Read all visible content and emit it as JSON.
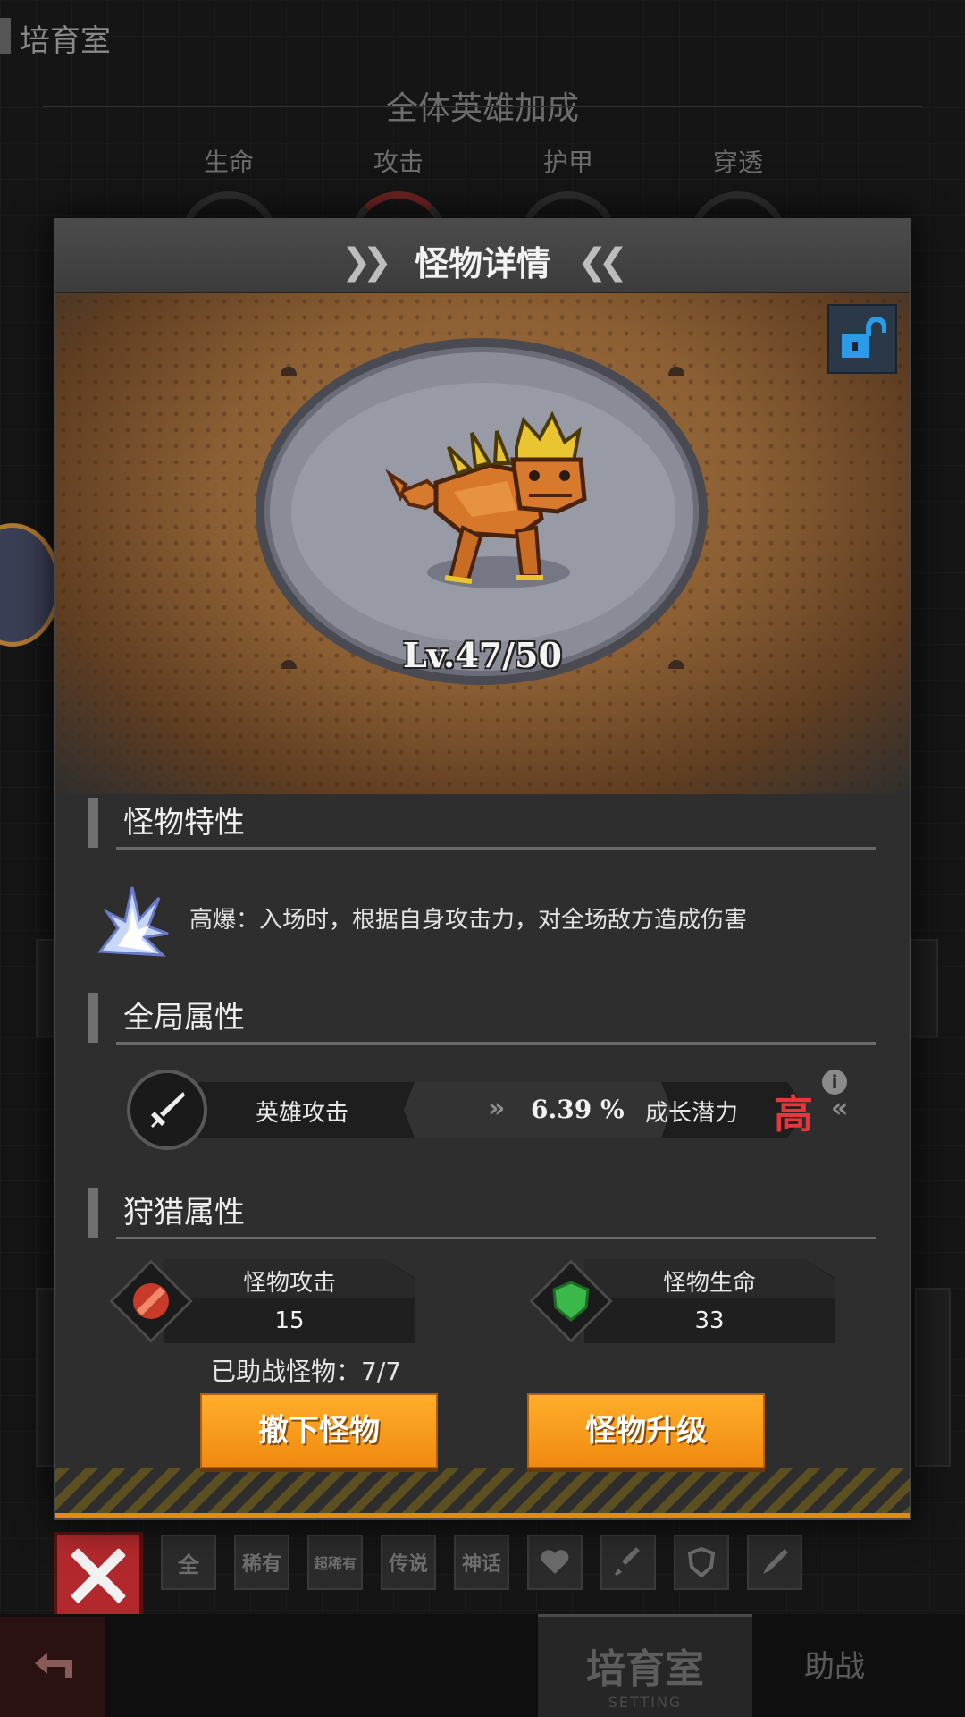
{
  "background": {
    "screen_title": "培育室",
    "bonus_title": "全体英雄加成",
    "stats": [
      {
        "label": "生命"
      },
      {
        "label": "攻击"
      },
      {
        "label": "护甲"
      },
      {
        "label": "穿透"
      }
    ]
  },
  "modal": {
    "title": "怪物详情",
    "level": "Lv.47/50",
    "sections": {
      "trait": "怪物特性",
      "global": "全局属性",
      "hunt": "狩猎属性"
    },
    "trait_text": "高爆：入场时，根据自身攻击力，对全场敌方造成伤害",
    "global_attr": {
      "name": "英雄攻击",
      "value": "6.39 %",
      "potential_label": "成长潜力",
      "potential_grade": "高"
    },
    "hunt": {
      "attack_label": "怪物攻击",
      "attack_value": "15",
      "hp_label": "怪物生命",
      "hp_value": "33"
    },
    "assist_text": "已助战怪物：7/7",
    "buttons": {
      "remove": "撤下怪物",
      "upgrade": "怪物升级"
    }
  },
  "filters": [
    "全",
    "稀有",
    "超稀有",
    "传说",
    "神话"
  ],
  "filter_icons": [
    "heart-icon",
    "sword-icon",
    "shield-icon",
    "pen-icon"
  ],
  "bottom_nav": {
    "active_tab": "培育室",
    "active_sub": "SETTING",
    "other_tab": "助战"
  },
  "colors": {
    "accent_orange": "#f59a1a",
    "grade_red": "#e8363c",
    "close_red": "#b2292d"
  }
}
